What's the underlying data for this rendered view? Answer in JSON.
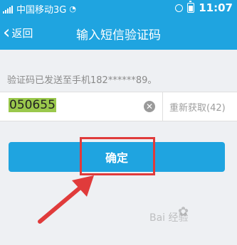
{
  "status_bar": {
    "carrier": "中国移动3G",
    "time": "11:07"
  },
  "nav": {
    "back_label": "返回",
    "title": "输入短信验证码"
  },
  "hint": "验证码已发送至手机182******89。",
  "input": {
    "value": "050655",
    "resend_label": "重新获取(42)"
  },
  "confirm_label": "确定",
  "watermark": "Bai 经验",
  "colors": {
    "brand": "#1fa4e0",
    "annotation": "#e03b3b",
    "code_highlight": "#9ac84c"
  }
}
